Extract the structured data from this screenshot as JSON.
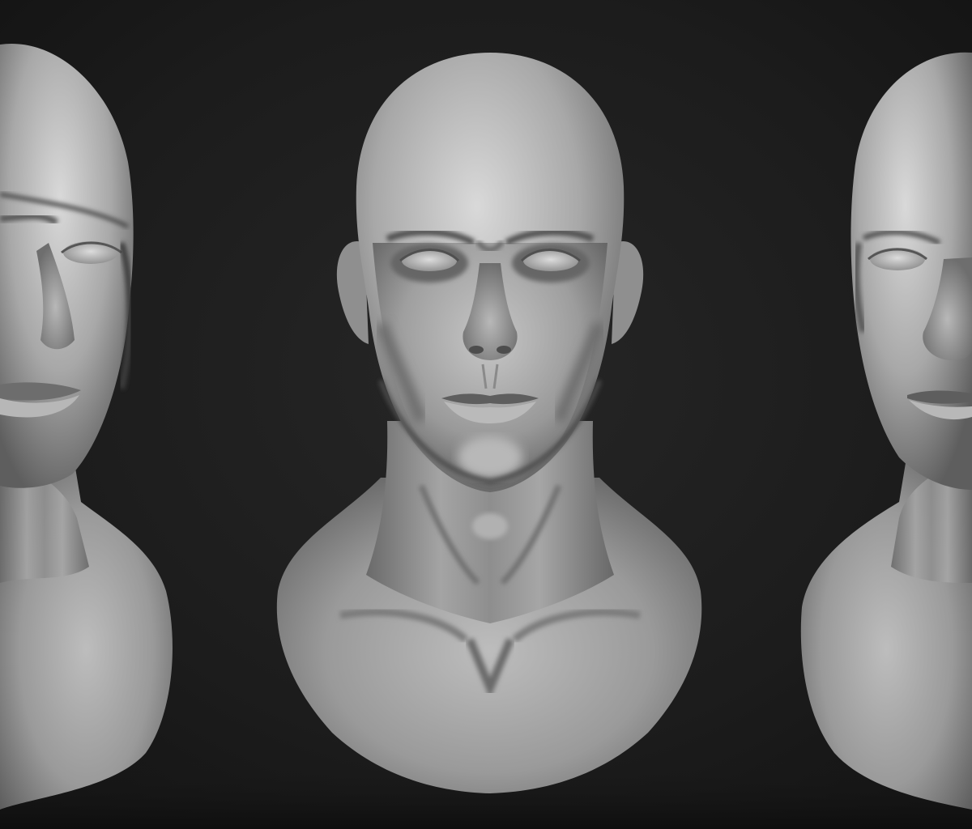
{
  "scene": {
    "description_kind": "render",
    "background_color": "#1d1d1d",
    "vignette_color": "#111111",
    "skin_light": "#d8d8d8",
    "skin_mid": "#9a9a9a",
    "skin_dark": "#3a3a3a",
    "busts": [
      {
        "id": "left",
        "view": "three-quarter-left",
        "visible": "partial-cropped-left"
      },
      {
        "id": "center",
        "view": "front",
        "visible": "full"
      },
      {
        "id": "right",
        "view": "three-quarter-right",
        "visible": "partial-cropped-right"
      }
    ]
  }
}
